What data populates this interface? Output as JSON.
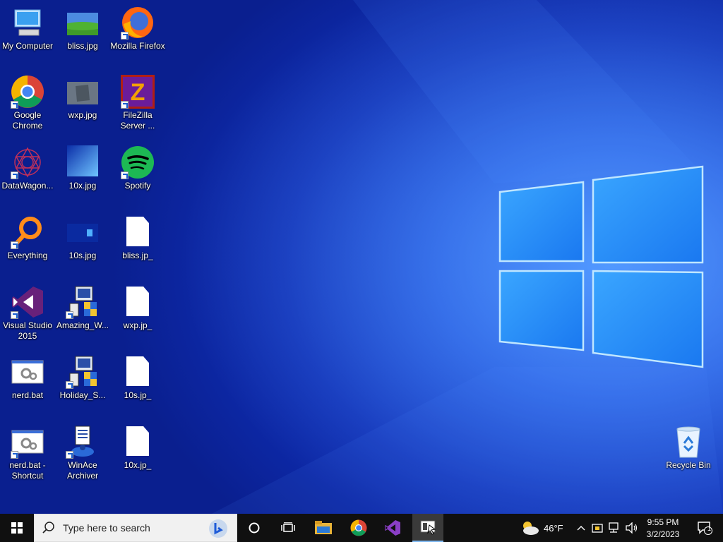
{
  "desktop": {
    "icons": [
      {
        "label": "My Computer"
      },
      {
        "label": "bliss.jpg"
      },
      {
        "label": "Mozilla Firefox"
      },
      {
        "label": "Google Chrome"
      },
      {
        "label": "wxp.jpg"
      },
      {
        "label": "FileZilla Server ..."
      },
      {
        "label": "DataWagon..."
      },
      {
        "label": "10x.jpg"
      },
      {
        "label": "Spotify"
      },
      {
        "label": "Everything"
      },
      {
        "label": "10s.jpg"
      },
      {
        "label": "bliss.jp_"
      },
      {
        "label": "Visual Studio 2015"
      },
      {
        "label": "Amazing_W..."
      },
      {
        "label": "wxp.jp_"
      },
      {
        "label": "nerd.bat"
      },
      {
        "label": "Holiday_S..."
      },
      {
        "label": "10s.jp_"
      },
      {
        "label": "nerd.bat - Shortcut"
      },
      {
        "label": "WinAce Archiver"
      },
      {
        "label": "10x.jp_"
      },
      {
        "label": "Recycle Bin"
      }
    ]
  },
  "taskbar": {
    "search_placeholder": "Type here to search",
    "weather_temp": "46°F",
    "time": "9:55 PM",
    "date": "3/2/2023",
    "notification_count": "1"
  }
}
